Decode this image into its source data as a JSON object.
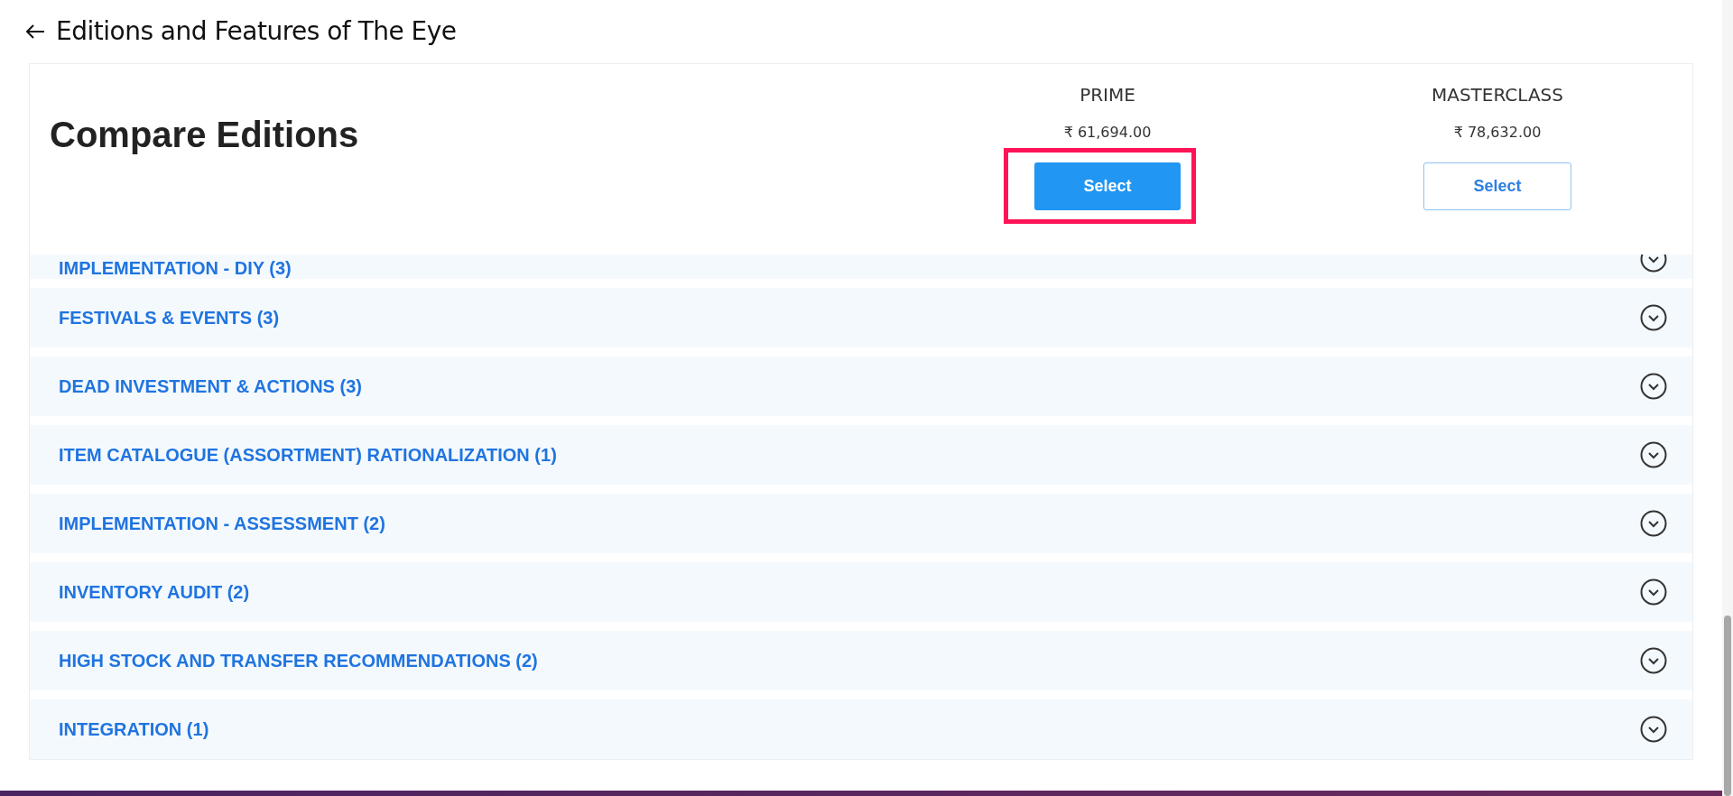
{
  "page_title": "Editions and Features of The Eye",
  "compare": {
    "heading": "Compare Editions",
    "editions": [
      {
        "name": "PRIME",
        "price": "₹ 61,694.00",
        "button": "Select",
        "selected": true,
        "highlighted": true
      },
      {
        "name": "MASTERCLASS",
        "price": "₹ 78,632.00",
        "button": "Select",
        "selected": false,
        "highlighted": false
      }
    ]
  },
  "categories": [
    {
      "label": "IMPLEMENTATION - DIY (3)",
      "expanded": false
    },
    {
      "label": "FESTIVALS & EVENTS (3)",
      "expanded": false
    },
    {
      "label": "DEAD INVESTMENT & ACTIONS (3)",
      "expanded": false
    },
    {
      "label": "ITEM CATALOGUE (ASSORTMENT) RATIONALIZATION (1)",
      "expanded": false
    },
    {
      "label": "IMPLEMENTATION - ASSESSMENT (2)",
      "expanded": false
    },
    {
      "label": "INVENTORY AUDIT (2)",
      "expanded": false
    },
    {
      "label": "HIGH STOCK AND TRANSFER RECOMMENDATIONS (2)",
      "expanded": false
    },
    {
      "label": "INTEGRATION (1)",
      "expanded": false
    }
  ]
}
